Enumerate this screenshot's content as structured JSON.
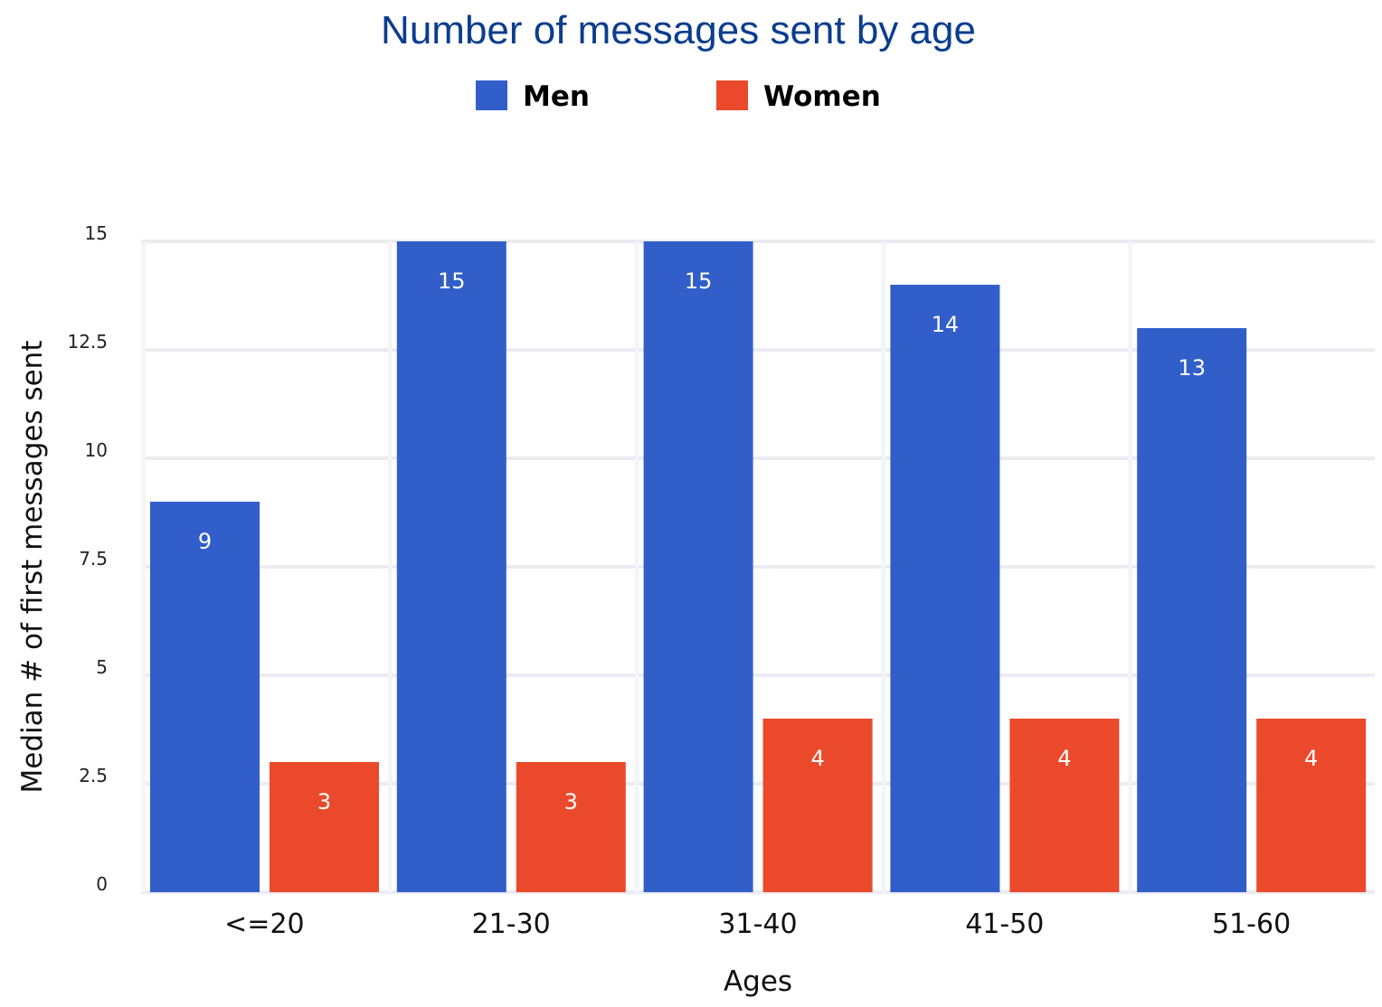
{
  "chart_data": {
    "type": "bar",
    "title": "Number of messages sent by age",
    "xlabel": "Ages",
    "ylabel": "Median # of first messages sent",
    "categories": [
      "<=20",
      "21-30",
      "31-40",
      "41-50",
      "51-60"
    ],
    "series": [
      {
        "name": "Men",
        "color": "#315ec9",
        "values": [
          9,
          15,
          15,
          14,
          13
        ]
      },
      {
        "name": "Women",
        "color": "#ea4a2b",
        "values": [
          3,
          3,
          4,
          4,
          4
        ]
      }
    ],
    "ylim": [
      0,
      15
    ],
    "yticks": [
      "15",
      "12.5",
      "10",
      "7.5",
      "5",
      "2.5",
      "0"
    ],
    "grid": true,
    "legend_position": "top-center",
    "data_labels": true
  }
}
